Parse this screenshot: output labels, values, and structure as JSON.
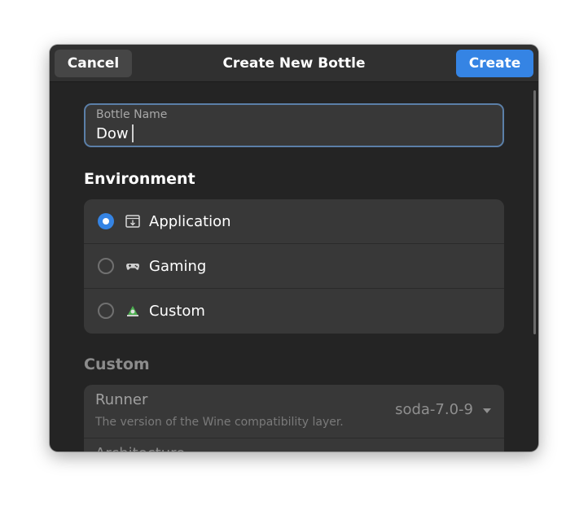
{
  "header": {
    "cancel_label": "Cancel",
    "title": "Create New Bottle",
    "create_label": "Create",
    "accent_color": "#3584e4"
  },
  "bottle_name": {
    "label": "Bottle Name",
    "value": "Dow"
  },
  "environment": {
    "title": "Environment",
    "options": [
      {
        "label": "Application",
        "icon": "application-icon",
        "selected": true
      },
      {
        "label": "Gaming",
        "icon": "gamepad-icon",
        "selected": false
      },
      {
        "label": "Custom",
        "icon": "custom-icon",
        "selected": false
      }
    ]
  },
  "custom": {
    "title": "Custom",
    "runner": {
      "title": "Runner",
      "subtitle": "The version of the Wine compatibility layer.",
      "value": "soda-7.0-9"
    },
    "architecture": {
      "title": "Architecture"
    }
  }
}
